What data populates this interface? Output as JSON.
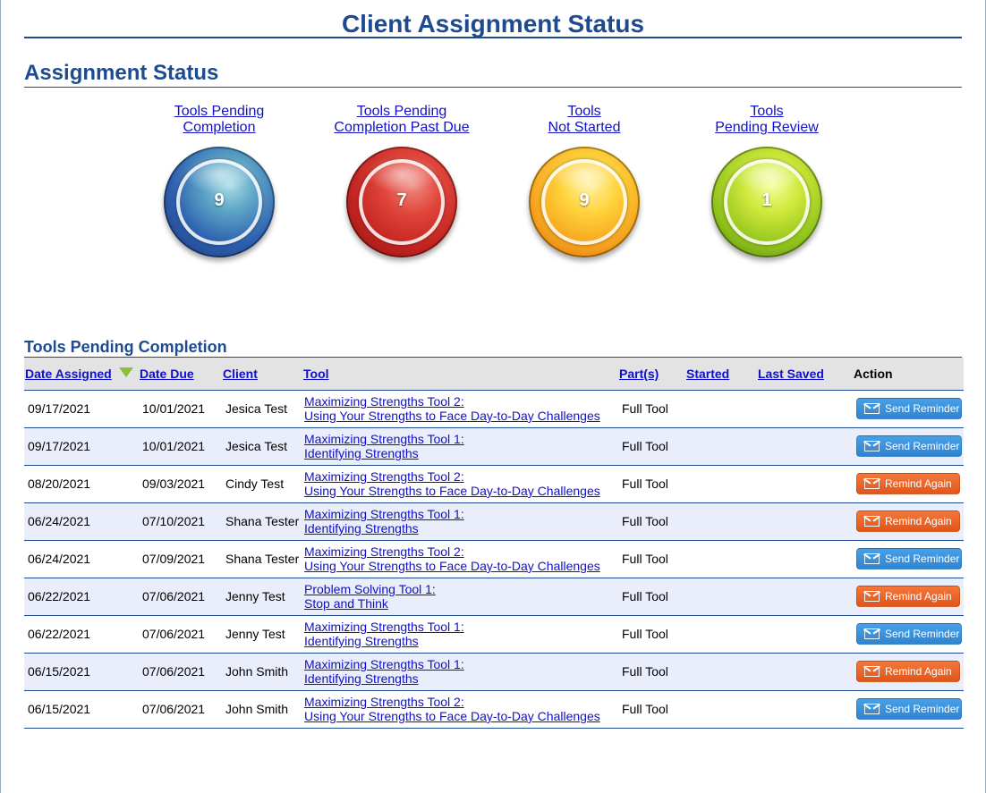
{
  "page": {
    "title": "Client Assignment Status"
  },
  "status_section": {
    "heading": "Assignment Status",
    "items": [
      {
        "label": "Tools Pending\nCompletion",
        "count": "9",
        "color": "blue"
      },
      {
        "label": "Tools Pending\nCompletion Past Due",
        "count": "7",
        "color": "red"
      },
      {
        "label": "Tools\nNot Started",
        "count": "9",
        "color": "orange"
      },
      {
        "label": "Tools\nPending Review",
        "count": "1",
        "color": "green"
      }
    ]
  },
  "table": {
    "heading": "Tools Pending Completion",
    "columns": {
      "date_assigned": "Date Assigned",
      "date_due": "Date Due",
      "client": "Client",
      "tool": "Tool",
      "parts": "Part(s)",
      "started": "Started",
      "last_saved": "Last Saved",
      "action": "Action"
    },
    "sort": {
      "column": "date_assigned",
      "direction": "descending",
      "indicator_color": "#8dbf3a"
    },
    "rows": [
      {
        "date_assigned": "09/17/2021",
        "date_due": "10/01/2021",
        "client": "Jesica Test",
        "tool_line1": "Maximizing Strengths Tool 2:",
        "tool_line2": "Using Your Strengths to Face Day-to-Day Challenges",
        "parts": "Full Tool",
        "started": "",
        "last_saved": "",
        "action": "Send Reminder",
        "action_type": "send"
      },
      {
        "date_assigned": "09/17/2021",
        "date_due": "10/01/2021",
        "client": "Jesica Test",
        "tool_line1": "Maximizing Strengths Tool 1:",
        "tool_line2": "Identifying Strengths",
        "parts": "Full Tool",
        "started": "",
        "last_saved": "",
        "action": "Send Reminder",
        "action_type": "send"
      },
      {
        "date_assigned": "08/20/2021",
        "date_due": "09/03/2021",
        "client": "Cindy Test",
        "tool_line1": "Maximizing Strengths Tool 2:",
        "tool_line2": "Using Your Strengths to Face Day-to-Day Challenges",
        "parts": "Full Tool",
        "started": "",
        "last_saved": "",
        "action": "Remind Again",
        "action_type": "again"
      },
      {
        "date_assigned": "06/24/2021",
        "date_due": "07/10/2021",
        "client": "Shana Tester",
        "tool_line1": "Maximizing Strengths Tool 1:",
        "tool_line2": "Identifying Strengths",
        "parts": "Full Tool",
        "started": "",
        "last_saved": "",
        "action": "Remind Again",
        "action_type": "again"
      },
      {
        "date_assigned": "06/24/2021",
        "date_due": "07/09/2021",
        "client": "Shana Tester",
        "tool_line1": "Maximizing Strengths Tool 2:",
        "tool_line2": "Using Your Strengths to Face Day-to-Day Challenges",
        "parts": "Full Tool",
        "started": "",
        "last_saved": "",
        "action": "Send Reminder",
        "action_type": "send"
      },
      {
        "date_assigned": "06/22/2021",
        "date_due": "07/06/2021",
        "client": "Jenny Test",
        "tool_line1": "Problem Solving Tool 1:",
        "tool_line2": "Stop and Think",
        "parts": "Full Tool",
        "started": "",
        "last_saved": "",
        "action": "Remind Again",
        "action_type": "again"
      },
      {
        "date_assigned": "06/22/2021",
        "date_due": "07/06/2021",
        "client": "Jenny Test",
        "tool_line1": "Maximizing Strengths Tool 1:",
        "tool_line2": "Identifying Strengths",
        "parts": "Full Tool",
        "started": "",
        "last_saved": "",
        "action": "Send Reminder",
        "action_type": "send"
      },
      {
        "date_assigned": "06/15/2021",
        "date_due": "07/06/2021",
        "client": "John Smith",
        "tool_line1": "Maximizing Strengths Tool 1:",
        "tool_line2": "Identifying Strengths",
        "parts": "Full Tool",
        "started": "",
        "last_saved": "",
        "action": "Remind Again",
        "action_type": "again"
      },
      {
        "date_assigned": "06/15/2021",
        "date_due": "07/06/2021",
        "client": "John Smith",
        "tool_line1": "Maximizing Strengths Tool 2:",
        "tool_line2": "Using Your Strengths to Face Day-to-Day Challenges",
        "parts": "Full Tool",
        "started": "",
        "last_saved": "",
        "action": "Send Reminder",
        "action_type": "send"
      }
    ]
  },
  "colors": {
    "heading_blue": "#1e4b8f",
    "link_blue": "#1010c8",
    "send_button": "#3a92dc",
    "remind_again_button": "#ea6428",
    "alt_row": "#eaeefb"
  }
}
